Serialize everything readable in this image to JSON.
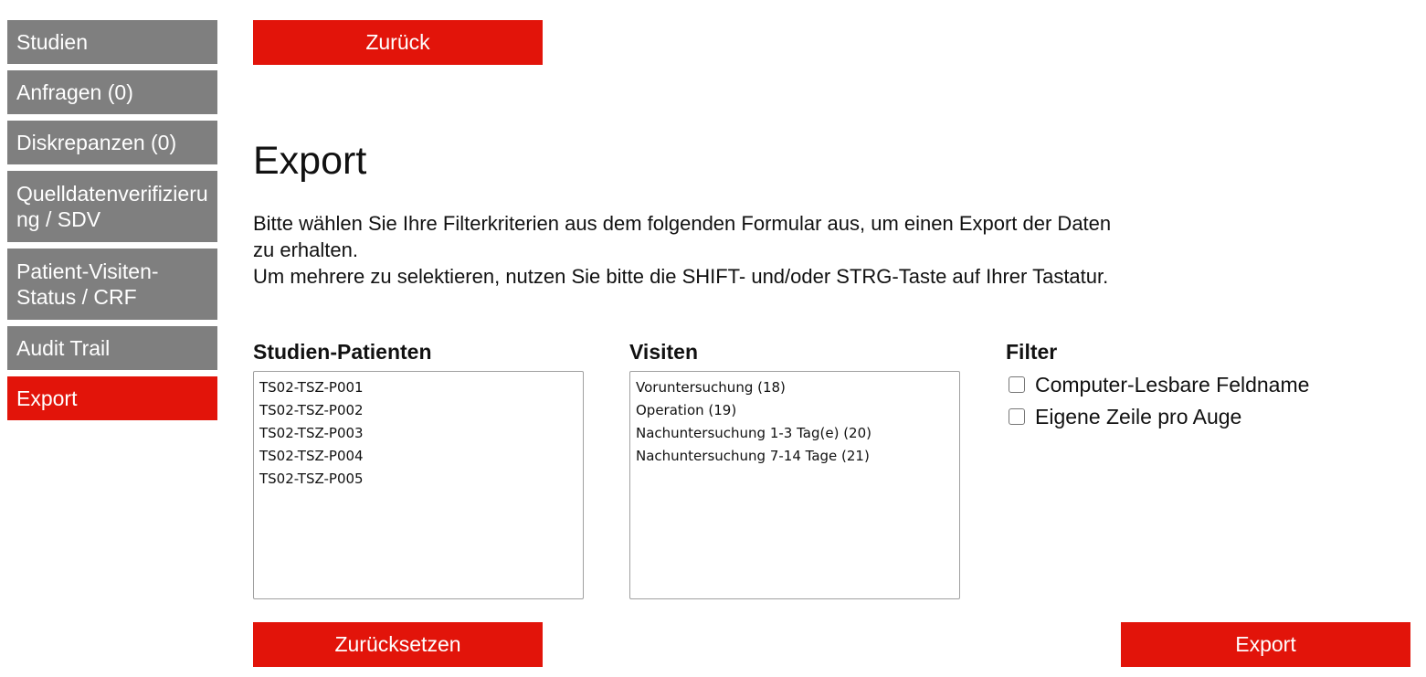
{
  "sidebar": {
    "items": [
      {
        "label": "Studien"
      },
      {
        "label": "Anfragen (0)"
      },
      {
        "label": "Diskrepanzen (0)"
      },
      {
        "label": "Quelldatenverifizierung / SDV"
      },
      {
        "label": "Patient-Visiten-Status / CRF"
      },
      {
        "label": "Audit Trail"
      },
      {
        "label": "Export",
        "active": true
      }
    ]
  },
  "main": {
    "back_label": "Zurück",
    "title": "Export",
    "intro_line1": "Bitte wählen Sie Ihre Filterkriterien aus dem folgenden Formular aus, um einen Export der Daten zu erhalten.",
    "intro_line2": "Um mehrere zu selektieren, nutzen Sie bitte die SHIFT- und/oder STRG-Taste auf Ihrer Tastatur.",
    "patients": {
      "heading": "Studien-Patienten",
      "options": [
        "TS02-TSZ-P001",
        "TS02-TSZ-P002",
        "TS02-TSZ-P003",
        "TS02-TSZ-P004",
        "TS02-TSZ-P005"
      ]
    },
    "visits": {
      "heading": "Visiten",
      "options": [
        "Voruntersuchung (18)",
        "Operation (19)",
        "Nachuntersuchung 1-3 Tag(e) (20)",
        "Nachuntersuchung 7-14 Tage (21)"
      ]
    },
    "filter": {
      "heading": "Filter",
      "options": [
        {
          "label": "Computer-Lesbare Feldname",
          "checked": false
        },
        {
          "label": "Eigene Zeile pro Auge",
          "checked": false
        }
      ]
    },
    "reset_label": "Zurücksetzen",
    "export_label": "Export"
  },
  "colors": {
    "accent": "#e2140a",
    "nav_bg": "#7f7f7f"
  }
}
